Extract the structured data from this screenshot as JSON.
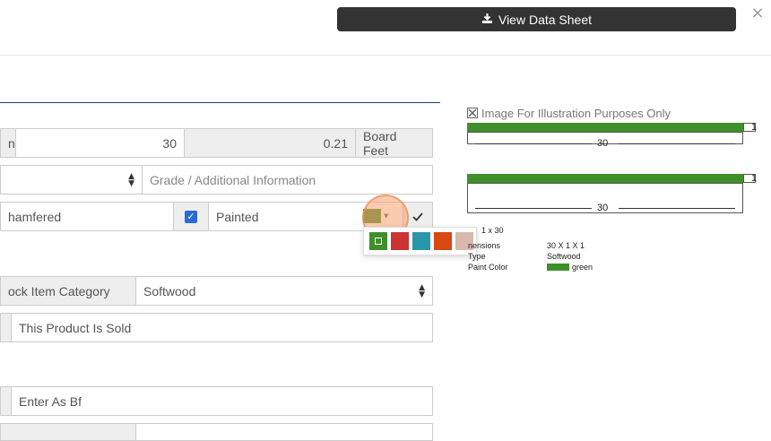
{
  "header": {
    "view_data_sheet_label": "View Data Sheet",
    "close_symbol": "×"
  },
  "form": {
    "row1": {
      "prefix": "n",
      "length_value": "30",
      "board_feet_value": "0.21",
      "board_feet_label": "Board Feet"
    },
    "row2": {
      "grade_placeholder": "Grade / Additional Information"
    },
    "row3": {
      "chamfered_label": "hamfered",
      "painted_label": "Painted",
      "painted_checked": true,
      "paint_color": "#4a8a2a"
    },
    "row4": {
      "category_label": "ock Item Category",
      "category_value": "Softwood"
    },
    "row5": {
      "sold_label": "This Product Is Sold"
    },
    "row6": {
      "enter_bf_label": "Enter As Bf"
    }
  },
  "color_picker": {
    "swatches": [
      "#3f8f2a",
      "#cc3333",
      "#2a96aa",
      "#d84a14",
      "#d9b8ae"
    ],
    "selected_index": 0
  },
  "illustration": {
    "note": "Image For Illustration Purposes Only",
    "board1": {
      "length_label": "30",
      "end_label": "1"
    },
    "board2": {
      "length_label": "30",
      "end_label": "1"
    },
    "bar_color": "#3f8f2a",
    "spec_title": "1 x 30",
    "specs": [
      {
        "label": "nensions",
        "value": "30 X 1 X 1"
      },
      {
        "label": "Type",
        "value": "Softwood"
      },
      {
        "label": "Paint Color",
        "value": "green",
        "swatch": "#3f8f2a"
      }
    ]
  }
}
